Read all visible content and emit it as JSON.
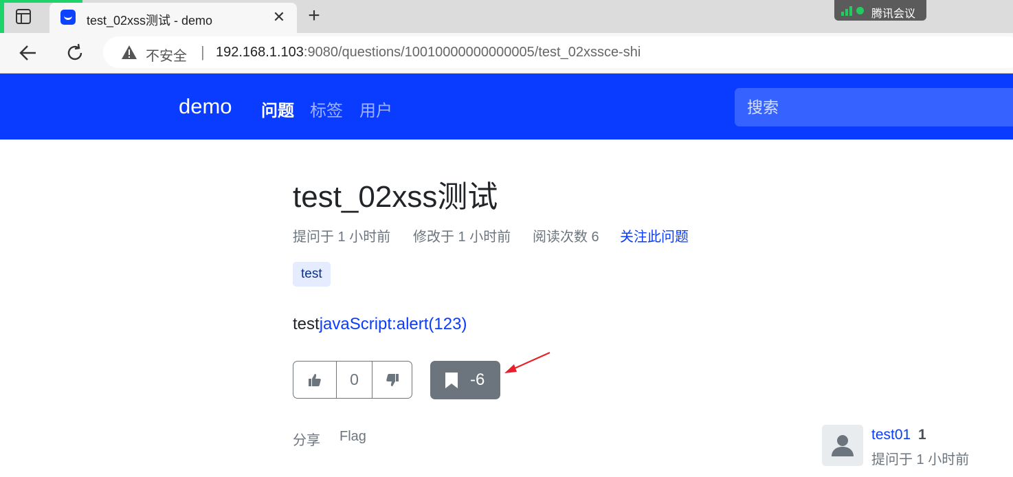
{
  "browser": {
    "tab_title": "test_02xss测试 - demo",
    "tab_close": "✕",
    "new_tab": "+",
    "meeting_label": "腾讯会议",
    "security_label": "不安全",
    "separator": "|",
    "url_host": "192.168.1.103",
    "url_rest": ":9080/questions/10010000000000005/test_02xssce-shi",
    "icons": [
      "tab-list-icon",
      "favicon-icon",
      "close-icon",
      "plus-icon",
      "signal-icon",
      "back-arrow-icon",
      "reload-icon",
      "warning-icon"
    ]
  },
  "navbar": {
    "brand": "demo",
    "items": [
      "问题",
      "标签",
      "用户"
    ],
    "search_placeholder": "搜索",
    "color": "#0a3cff"
  },
  "question": {
    "title": "test_02xss测试",
    "asked": "提问于 1 小时前",
    "modified": "修改于 1 小时前",
    "views": "阅读次数 6",
    "follow": "关注此问题",
    "tag": "test",
    "body_text": "test",
    "body_link": "javaScript:alert(123)",
    "vote_count": "0",
    "bookmark_count": "-6",
    "share": "分享",
    "flag": "Flag"
  },
  "author": {
    "name": "test01",
    "reputation": "1",
    "asked": "提问于 1 小时前"
  }
}
